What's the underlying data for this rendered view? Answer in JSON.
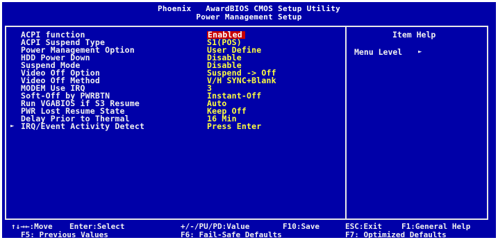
{
  "header": {
    "vendor": "Phoenix",
    "title": "AwardBIOS CMOS Setup Utility",
    "subtitle": "Power Management Setup"
  },
  "settings": [
    {
      "label": "ACPI function",
      "value": "Enabled",
      "selected": true
    },
    {
      "label": "ACPI Suspend Type",
      "value": "S1(POS)"
    },
    {
      "label": "Power Management Option",
      "value": "User Define"
    },
    {
      "label": "HDD Power Down",
      "value": "Disable"
    },
    {
      "label": "Suspend Mode",
      "value": "Disable"
    },
    {
      "label": "Video Off Option",
      "value": "Suspend -> Off"
    },
    {
      "label": "Video Off Method",
      "value": "V/H SYNC+Blank"
    },
    {
      "label": "MODEM Use IRQ",
      "value": "3"
    },
    {
      "label": "Soft-Off by PWRBTN",
      "value": "Instant-Off"
    },
    {
      "label": "Run VGABIOS if S3 Resume",
      "value": "Auto"
    },
    {
      "label": "PWR Lost Resume State",
      "value": "Keep Off"
    },
    {
      "label": "Delay Prior to Thermal",
      "value": "16 Min"
    },
    {
      "label": "IRQ/Event Activity Detect",
      "value": "Press Enter",
      "submenu": true
    }
  ],
  "help": {
    "title": "Item Help",
    "menu_level": "Menu Level"
  },
  "footer": {
    "line1": {
      "move": "↑↓→←:Move",
      "select": "Enter:Select",
      "value": "+/-/PU/PD:Value",
      "save": "F10:Save",
      "exit": "ESC:Exit",
      "help": "F1:General Help"
    },
    "line2": {
      "previous": "F5: Previous Values",
      "failsafe": "F6: Fail-Safe Defaults",
      "optimized": "F7: Optimized Defaults"
    }
  },
  "colors": {
    "background": "#0000a8",
    "label": "#f0f0f0",
    "value": "#ffff40",
    "highlight": "#c80000"
  }
}
